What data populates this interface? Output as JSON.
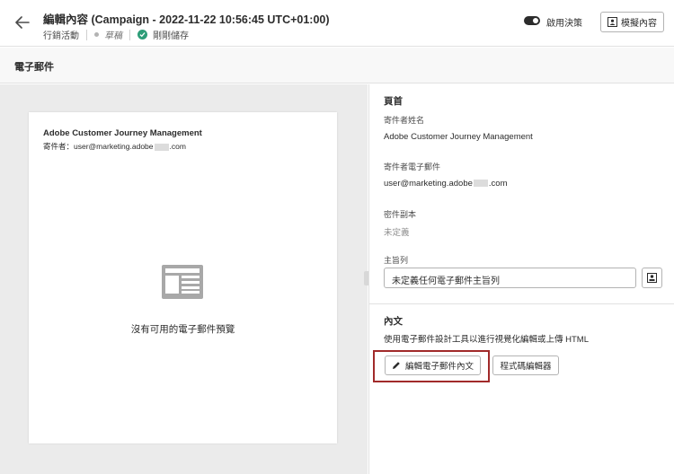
{
  "header": {
    "title": "編輯內容 (Campaign - 2022-11-22 10:56:45 UTC+01:00)",
    "breadcrumb": "行銷活動",
    "status": "草稿",
    "saved": "剛剛儲存",
    "toggle_label": "啟用決策",
    "simulate_label": "模擬內容"
  },
  "section": {
    "title": "電子郵件"
  },
  "preview": {
    "sender_name": "Adobe Customer Journey Management",
    "from_prefix": "寄件者：",
    "from_addr_start": "user@marketing.adobe",
    "from_addr_end": ".com",
    "no_preview": "沒有可用的電子郵件預覽"
  },
  "panel": {
    "header_heading": "頁首",
    "sender_name_label": "寄件者姓名",
    "sender_name_value": "Adobe Customer Journey Management",
    "sender_email_label": "寄件者電子郵件",
    "sender_email_start": "user@marketing.adobe",
    "sender_email_end": ".com",
    "bcc_label": "密件副本",
    "bcc_value": "未定義",
    "subject_label": "主旨列",
    "subject_value": "未定義任何電子郵件主旨列",
    "body_heading": "內文",
    "body_desc": "使用電子郵件設計工具以進行視覺化編輯或上傳 HTML",
    "edit_body_label": "編輯電子郵件內文",
    "code_editor_label": "程式碼編輯器"
  },
  "colors": {
    "saved_check": "#2d9d78",
    "highlight_border": "#a12a2a"
  }
}
